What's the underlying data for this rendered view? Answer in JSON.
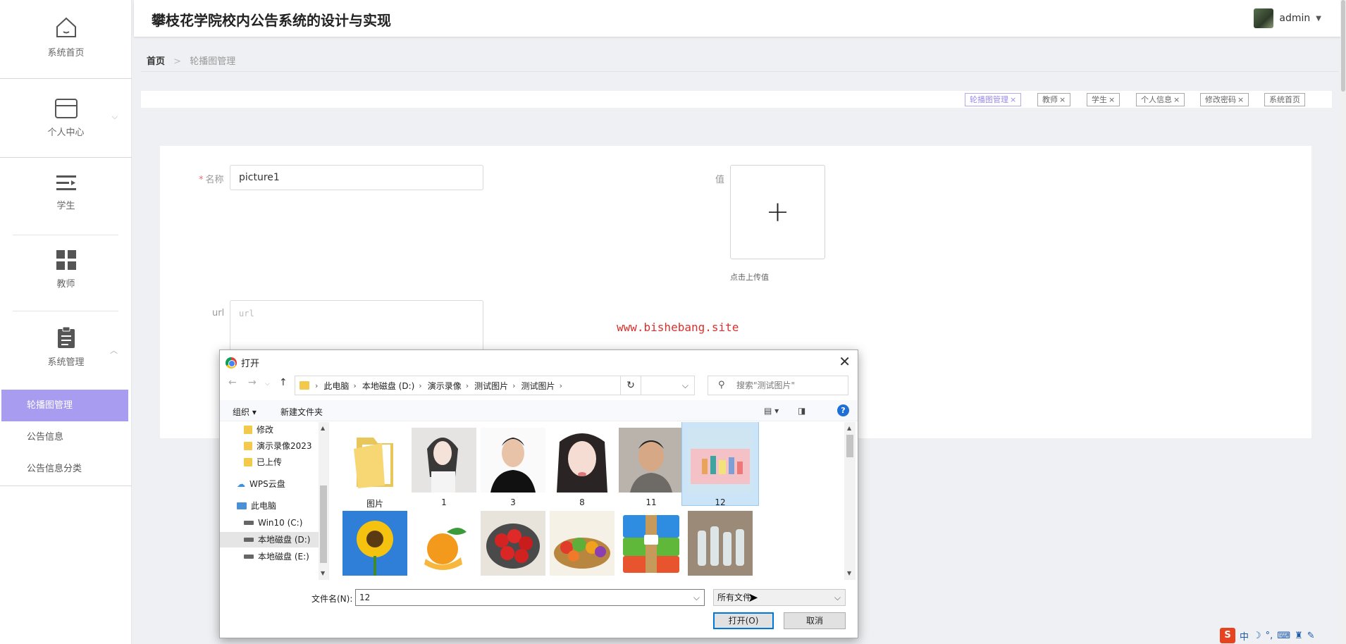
{
  "sidebar": {
    "items": [
      {
        "label": "系统首页"
      },
      {
        "label": "个人中心"
      },
      {
        "label": "学生"
      },
      {
        "label": "教师"
      },
      {
        "label": "系统管理"
      }
    ],
    "submenu": [
      {
        "label": "轮播图管理"
      },
      {
        "label": "公告信息"
      },
      {
        "label": "公告信息分类"
      }
    ]
  },
  "header": {
    "title": "攀枝花学院校内公告系统的设计与实现",
    "username": "admin",
    "dropdown_glyph": "▼"
  },
  "breadcrumb": {
    "home": "首页",
    "separator": ">",
    "current": "轮播图管理"
  },
  "tags": [
    {
      "label": "轮播图管理"
    },
    {
      "label": "教师"
    },
    {
      "label": "学生"
    },
    {
      "label": "个人信息"
    },
    {
      "label": "修改密码"
    },
    {
      "label": "系统首页"
    }
  ],
  "form": {
    "name_required": "*",
    "name_label": "名称",
    "name_value": "picture1",
    "value_label": "值",
    "upload_hint": "点击上传值",
    "url_label": "url",
    "url_placeholder": "url"
  },
  "watermark": "www.bishebang.site",
  "dialog": {
    "title": "打开",
    "path": [
      "此电脑",
      "本地磁盘 (D:)",
      "演示录像",
      "测试图片",
      "测试图片"
    ],
    "search_placeholder": "搜索\"测试图片\"",
    "organize": "组织 ▾",
    "new_folder": "新建文件夹",
    "tree": [
      {
        "label": "修改"
      },
      {
        "label": "演示录像2023"
      },
      {
        "label": "已上传"
      },
      {
        "label": "WPS云盘"
      },
      {
        "label": "此电脑"
      },
      {
        "label": "Win10 (C:)"
      },
      {
        "label": "本地磁盘 (D:)"
      },
      {
        "label": "本地磁盘 (E:)"
      }
    ],
    "files": [
      {
        "label": "图片",
        "icon": "folder"
      },
      {
        "label": "1",
        "icon": "photo-woman"
      },
      {
        "label": "3",
        "icon": "photo-man"
      },
      {
        "label": "8",
        "icon": "photo-woman"
      },
      {
        "label": "11",
        "icon": "photo-man"
      },
      {
        "label": "12",
        "icon": "photo-products",
        "selected": true
      },
      {
        "label": "",
        "icon": "photo-sunflower"
      },
      {
        "label": "",
        "icon": "photo-orange"
      },
      {
        "label": "",
        "icon": "photo-strawberry"
      },
      {
        "label": "",
        "icon": "photo-vegetables"
      },
      {
        "label": "",
        "icon": "archive"
      },
      {
        "label": "",
        "icon": "photo-bottles"
      }
    ],
    "filename_label": "文件名(N):",
    "filename_value": "12",
    "filetype_value": "所有文件",
    "open_button": "打开(O)",
    "cancel_button": "取消"
  },
  "colors": {
    "accent": "#a89cf0",
    "watermark": "#d9302c",
    "dialog_selection": "#cce4f7"
  }
}
